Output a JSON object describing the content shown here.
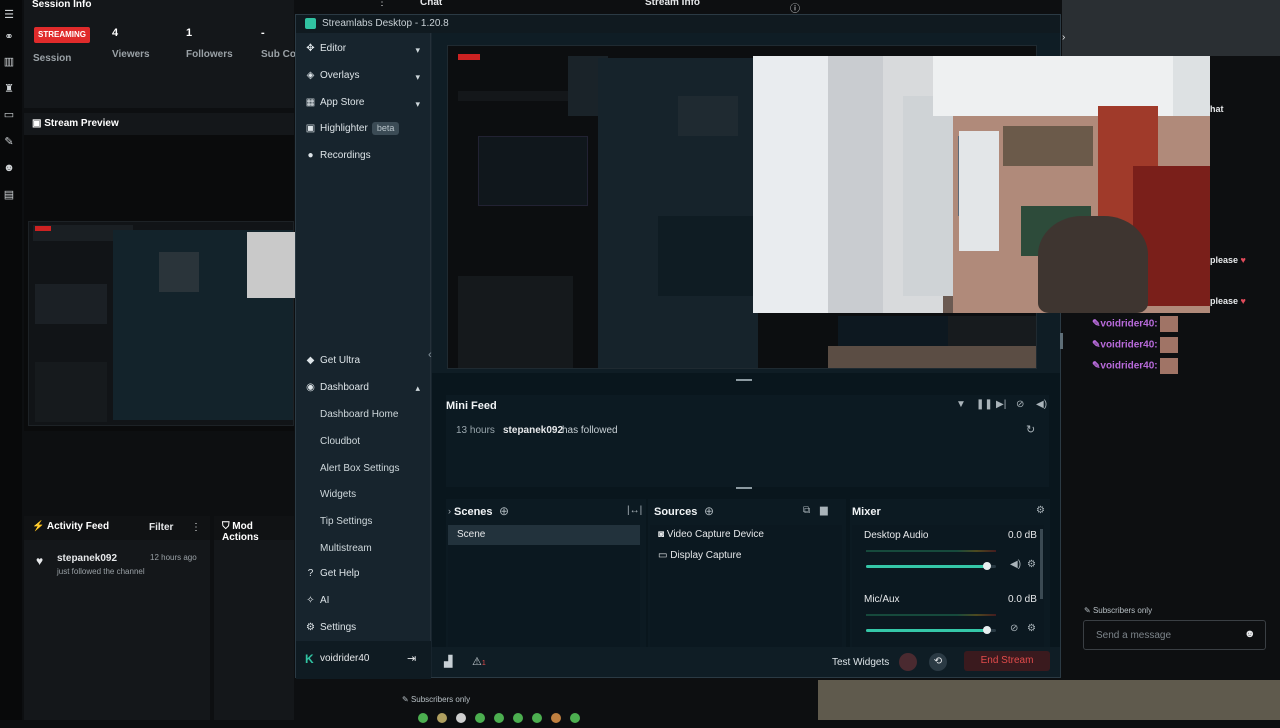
{
  "dashboard": {
    "session_info_title": "Session Info",
    "chat_title": "Chat",
    "stream_info_title": "Stream Info",
    "streaming_badge": "STREAMING",
    "session_label": "Session",
    "viewers_value": "4",
    "viewers_label": "Viewers",
    "followers_value": "1",
    "followers_label": "Followers",
    "sub_label": "Sub Co",
    "stream_preview_title": "Stream Preview",
    "activity_feed_title": "Activity Feed",
    "filter_label": "Filter",
    "mod_actions_title": "Mod Actions",
    "activity_user": "stepanek092",
    "activity_time": "12 hours ago",
    "activity_text": "just followed the channel",
    "subscribers_only": "Subscribers only",
    "chat_header_partial": "hat"
  },
  "streamlabs": {
    "title": "Streamlabs Desktop - 1.20.8",
    "sidebar": {
      "editor": "Editor",
      "overlays": "Overlays",
      "app_store": "App Store",
      "highlighter": "Highlighter",
      "beta": "beta",
      "recordings": "Recordings",
      "get_ultra": "Get Ultra",
      "dashboard": "Dashboard",
      "dashboard_home": "Dashboard Home",
      "cloudbot": "Cloudbot",
      "alert_box": "Alert Box Settings",
      "widgets": "Widgets",
      "tip_settings": "Tip Settings",
      "multistream": "Multistream",
      "get_help": "Get Help",
      "ai": "AI",
      "settings": "Settings",
      "username": "voidrider40"
    },
    "mini_feed": {
      "title": "Mini Feed",
      "time": "13 hours",
      "user": "stepanek092",
      "action": "has followed"
    },
    "scenes": {
      "title": "Scenes",
      "items": [
        "Scene"
      ]
    },
    "sources": {
      "title": "Sources",
      "items": [
        "Video Capture Device",
        "Display Capture"
      ]
    },
    "mixer": {
      "title": "Mixer",
      "channels": [
        {
          "name": "Desktop Audio",
          "db": "0.0 dB",
          "level": 0.93
        },
        {
          "name": "Mic/Aux",
          "db": "0.0 dB",
          "level": 0.93
        }
      ]
    },
    "bottom": {
      "test_widgets": "Test Widgets",
      "end_stream": "End Stream"
    }
  },
  "chat": {
    "messages": [
      {
        "text": "please"
      },
      {
        "text": "please"
      }
    ],
    "users": [
      "voidrider40:",
      "voidrider40:",
      "voidrider40:"
    ],
    "subscribers_only": "Subscribers only",
    "placeholder": "Send a message"
  },
  "colors": {
    "accent": "#31c3a2",
    "streaming_red": "#e02b2b",
    "username_purple": "#b86bdb"
  }
}
